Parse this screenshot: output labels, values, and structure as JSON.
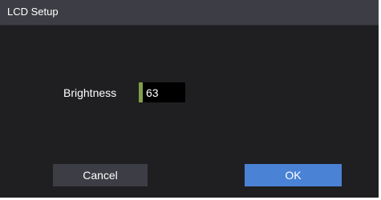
{
  "dialog": {
    "title": "LCD Setup"
  },
  "brightness": {
    "label": "Brightness",
    "value": "63"
  },
  "buttons": {
    "cancel_label": "Cancel",
    "ok_label": "OK"
  },
  "colors": {
    "titlebar": "#3d3e45",
    "background": "#1f1f22",
    "value_indicator": "#7fa04a",
    "ok_button": "#4a82d6",
    "cancel_button": "#3c3d45"
  }
}
